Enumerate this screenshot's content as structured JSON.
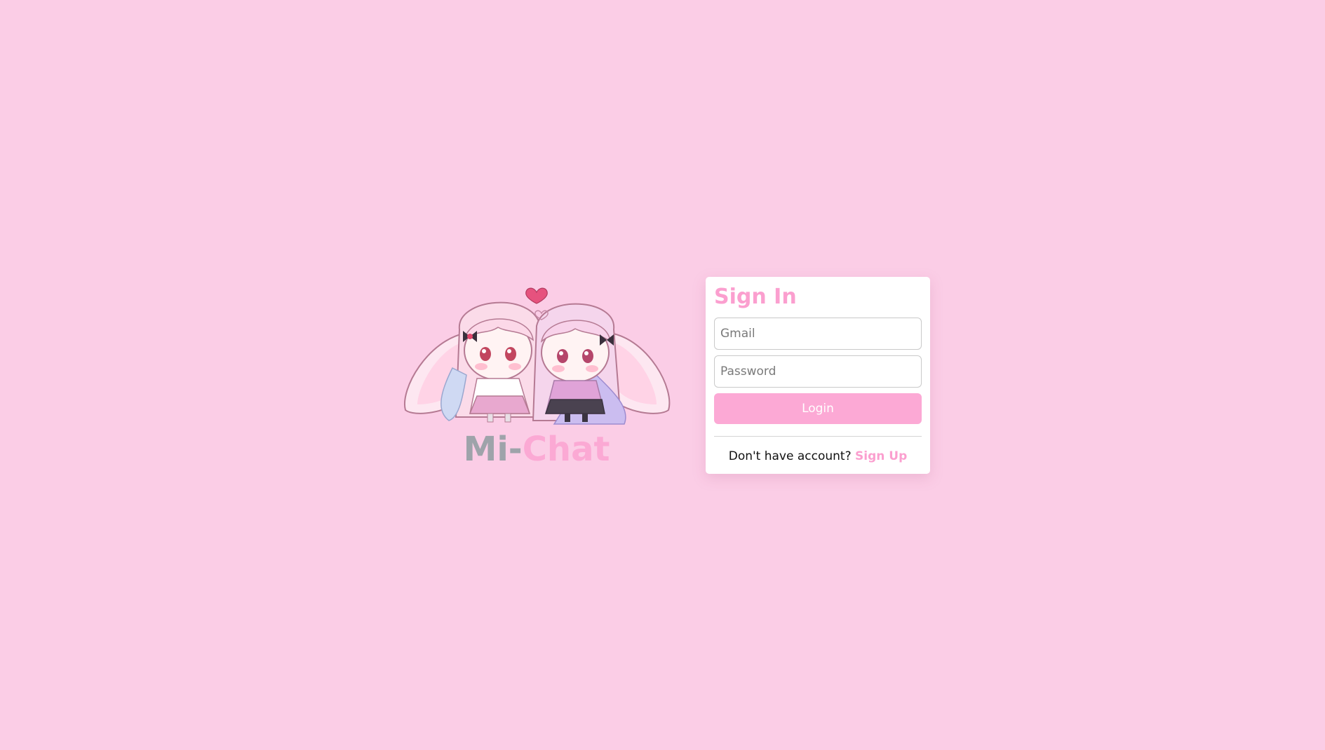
{
  "brand": {
    "name_part1": "Mi-",
    "name_part2": "Chat",
    "illustration": "two-chibi-bunny-girls-with-heart"
  },
  "signin": {
    "title": "Sign In",
    "email_placeholder": "Gmail",
    "email_value": "",
    "password_placeholder": "Password",
    "password_value": "",
    "login_label": "Login",
    "no_account_text": "Don't have account?",
    "signup_label": "Sign Up"
  },
  "colors": {
    "background": "#fbcde6",
    "accent_pink": "#fb9fcf",
    "button_pink": "#fca9d5",
    "wordmark_gray": "#9ea3aa",
    "card_bg": "#ffffff"
  }
}
